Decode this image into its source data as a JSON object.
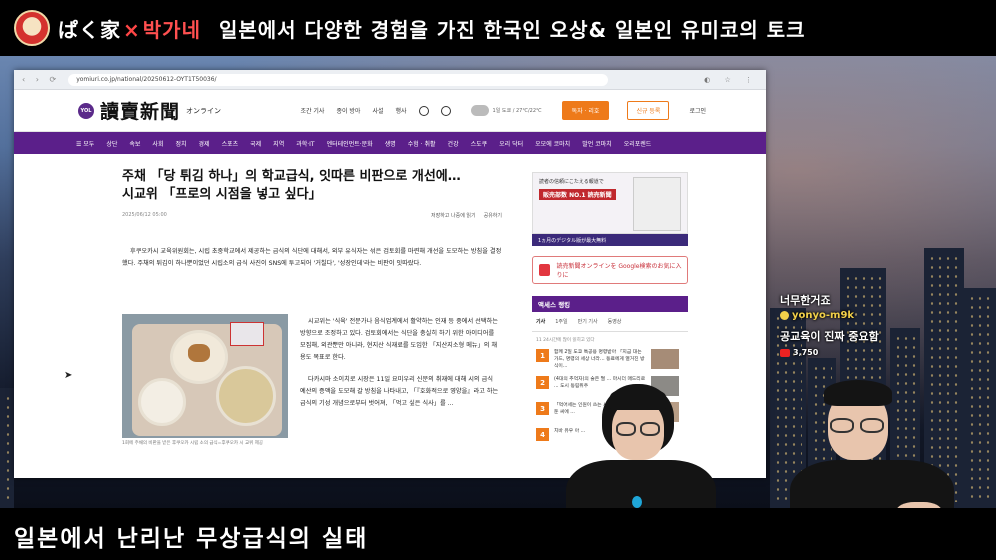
{
  "banner": {
    "brand_jp": "ぱく家",
    "brand_x": "×",
    "brand_kr": "박가네",
    "title": "일본에서 다양한 경험을 가진 한국인 오상& 일본인 유미코의 토크"
  },
  "bottom": {
    "title": "일본에서 난리난 무상급식의 실태"
  },
  "browser": {
    "url": "yomiuri.co.jp/national/20250612-OYT1T50036/",
    "site": {
      "badge": "YOL",
      "logo": "讀賣新聞",
      "logo_sub": "オンライン",
      "links": [
        "조간 기사",
        "종이 방아",
        "사설",
        "행사"
      ],
      "weather": "1일 도쿄 / 27℃/22℃",
      "btn_subscribe": "독자 · 리호",
      "btn_register": "신규 등록",
      "login": "로그인"
    },
    "nav": [
      "☰ 모두",
      "상단",
      "속보",
      "사회",
      "정치",
      "경제",
      "스포츠",
      "국제",
      "지역",
      "과학·IT",
      "엔터테인먼트·문화",
      "생명",
      "수험 · 취활",
      "건강",
      "스도쿠",
      "오리 닥터",
      "오모에 코마치",
      "발언 코마치",
      "오리포렌드"
    ],
    "article": {
      "headline_1": "주채 「당 튀김 하나」의 학교급식, 잇따른 비판으로 개선에…",
      "headline_2": "시교위 「프로의 시점을 넣고 싶다」",
      "date": "2025/06/12 05:00",
      "save_link": "저장하고 나중에 읽기",
      "share_link": "공유하기",
      "lead": "후쿠오카시 교육위원회는, 시립 초중학교에서 제공하는 급식의 식단에 대해서, 외부 유식자는 섞은 검토회를 마련해 개선을 도모하는 방침을 결정했다. 주채의 튀김이 하나뿐이었던 시립소의 급식 사진이 SNS에 투고되어 '거칠다', '성장인데'라는 비판이 잇따랐다.",
      "photo_caption": "1회에 주채의 비판을 받은 후쿠오카 시립 소의 급식=후쿠오카 시 교위 제공",
      "body_1": "시교위는 '식육' 전문가나 음식업계에서 활약하는 인재 등 중에서 선택하는 방향으로 조정하고 있다. 검토회에서는 식단을 충실히 하기 위한 아이디어를 모집해, 외관뿐만 아니라, 현지산 식재료를 도입한 「지산지소형 메뉴」의 채용도 목표로 한다.",
      "body_2": "다카시마 소이치로 시장은 11일 요미우리 신문의 취재에 대해 시의 급식 예산의 증액을 도모해 갈 방침을 나타내고, 「『호화적으로 영양을』라고 하는 급식의 기성 개념으로부터 벗어져, 「먹고 싶은 식사」를 ..."
    },
    "sidebar": {
      "ad_line": "読者の信頼にこたえる報道で",
      "ad_red": "販売部数 NO.1 読売新聞",
      "ad_strip": "1ヵ月のデジタル版が最大無料",
      "google_box": "読売新聞オンラインを Google検索のお気に入りに",
      "ranking_title": "액세스 랭킹",
      "rank_tabs": [
        "기사",
        "1주일",
        "만기 기사",
        "동영상"
      ],
      "rank_note": "11 24시간에 많이 읽히고 있다",
      "ranks": [
        {
          "num": "1",
          "text": "함께 2일 도쿄 특공용 명령받아 「지금 대는 가드, 명령의 세상 너라… 동료에게 열거진 방식이..."
        },
        {
          "num": "2",
          "text": "(4대의 추억자)의 술은 떨 ... 마시더 매드리로 ... 도시 동림위주"
        },
        {
          "num": "3",
          "text": "「먹어세는 인원이 쓰는 시간 ... 을 따난 볼을둔 씨에 ..."
        },
        {
          "num": "4",
          "text": "치바 유우 아 ..."
        }
      ]
    }
  },
  "chat": {
    "line1": "너무한거죠",
    "user": "yonyo-m9k",
    "line2": "공교육이 진짜 중요함",
    "subs": "3,750"
  },
  "colors": {
    "purple": "#5b1f8a",
    "orange": "#ee7a1a",
    "red": "#d4322e"
  }
}
